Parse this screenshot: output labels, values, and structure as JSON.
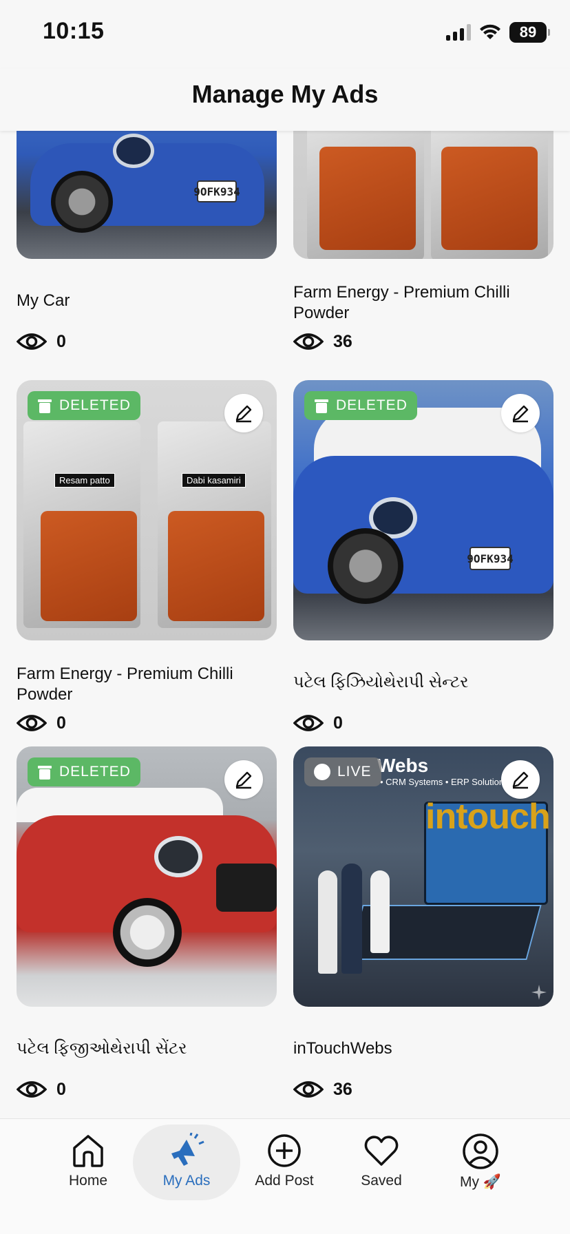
{
  "status_bar": {
    "time": "10:15",
    "battery": "89"
  },
  "header": {
    "title": "Manage My Ads"
  },
  "ads": [
    {
      "title": "My Car",
      "views": "0",
      "badge": "",
      "image": "blue-car-front"
    },
    {
      "title": "Farm Energy - Premium Chilli Powder",
      "views": "36",
      "badge": "",
      "image": "chilli-packs"
    },
    {
      "title": "Farm Energy - Premium Chilli Powder",
      "views": "0",
      "badge": "DELETED",
      "image": "chilli-packs",
      "pack_labels": [
        "Resam patto",
        "Dabi kasamiri"
      ]
    },
    {
      "title": "પટેલ ફિઝિયોથેરાપી સેન્ટર",
      "views": "0",
      "badge": "DELETED",
      "image": "blue-car"
    },
    {
      "title": "પટેલ ફિજીઓથેરાપી સેંટર",
      "views": "0",
      "badge": "DELETED",
      "image": "red-car"
    },
    {
      "title": "inTouchWebs",
      "views": "36",
      "badge": "LIVE",
      "image": "office-dashboard",
      "overlay": {
        "heading": "Webs",
        "tagline": "• CRM Systems • ERP Solutions",
        "brand": "intouch"
      }
    }
  ],
  "plates": {
    "car_top": "9OFK934",
    "car_mid": "9OFK934"
  },
  "bottom_nav": [
    {
      "label": "Home",
      "icon": "home-icon"
    },
    {
      "label": "My Ads",
      "icon": "megaphone-icon",
      "active": true
    },
    {
      "label": "Add Post",
      "icon": "plus-circle-icon"
    },
    {
      "label": "Saved",
      "icon": "heart-icon"
    },
    {
      "label": "My 🚀",
      "icon": "profile-icon"
    }
  ],
  "colors": {
    "deleted": "#5cb865",
    "active_nav": "#2a6ebd"
  }
}
